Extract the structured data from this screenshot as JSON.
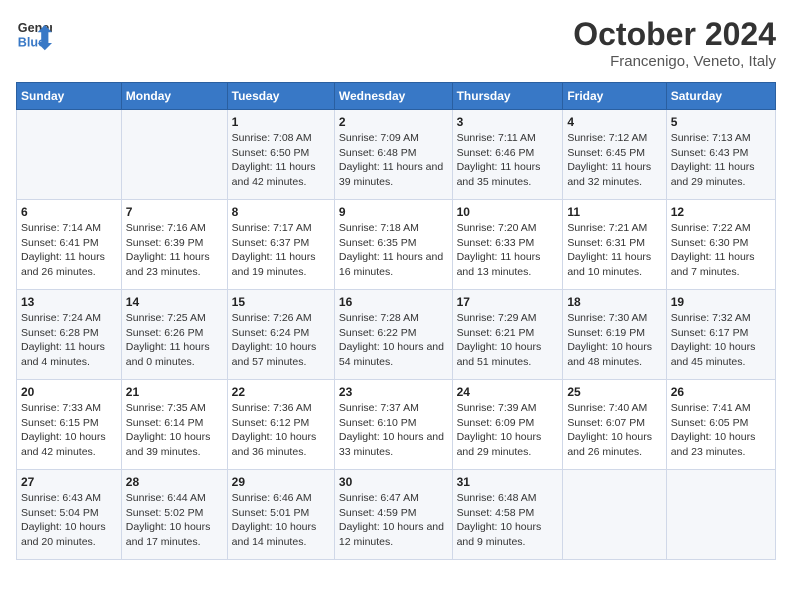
{
  "header": {
    "logo_line1": "General",
    "logo_line2": "Blue",
    "title": "October 2024",
    "subtitle": "Francenigo, Veneto, Italy"
  },
  "weekdays": [
    "Sunday",
    "Monday",
    "Tuesday",
    "Wednesday",
    "Thursday",
    "Friday",
    "Saturday"
  ],
  "weeks": [
    [
      {
        "day": "",
        "info": ""
      },
      {
        "day": "",
        "info": ""
      },
      {
        "day": "1",
        "info": "Sunrise: 7:08 AM\nSunset: 6:50 PM\nDaylight: 11 hours and 42 minutes."
      },
      {
        "day": "2",
        "info": "Sunrise: 7:09 AM\nSunset: 6:48 PM\nDaylight: 11 hours and 39 minutes."
      },
      {
        "day": "3",
        "info": "Sunrise: 7:11 AM\nSunset: 6:46 PM\nDaylight: 11 hours and 35 minutes."
      },
      {
        "day": "4",
        "info": "Sunrise: 7:12 AM\nSunset: 6:45 PM\nDaylight: 11 hours and 32 minutes."
      },
      {
        "day": "5",
        "info": "Sunrise: 7:13 AM\nSunset: 6:43 PM\nDaylight: 11 hours and 29 minutes."
      }
    ],
    [
      {
        "day": "6",
        "info": "Sunrise: 7:14 AM\nSunset: 6:41 PM\nDaylight: 11 hours and 26 minutes."
      },
      {
        "day": "7",
        "info": "Sunrise: 7:16 AM\nSunset: 6:39 PM\nDaylight: 11 hours and 23 minutes."
      },
      {
        "day": "8",
        "info": "Sunrise: 7:17 AM\nSunset: 6:37 PM\nDaylight: 11 hours and 19 minutes."
      },
      {
        "day": "9",
        "info": "Sunrise: 7:18 AM\nSunset: 6:35 PM\nDaylight: 11 hours and 16 minutes."
      },
      {
        "day": "10",
        "info": "Sunrise: 7:20 AM\nSunset: 6:33 PM\nDaylight: 11 hours and 13 minutes."
      },
      {
        "day": "11",
        "info": "Sunrise: 7:21 AM\nSunset: 6:31 PM\nDaylight: 11 hours and 10 minutes."
      },
      {
        "day": "12",
        "info": "Sunrise: 7:22 AM\nSunset: 6:30 PM\nDaylight: 11 hours and 7 minutes."
      }
    ],
    [
      {
        "day": "13",
        "info": "Sunrise: 7:24 AM\nSunset: 6:28 PM\nDaylight: 11 hours and 4 minutes."
      },
      {
        "day": "14",
        "info": "Sunrise: 7:25 AM\nSunset: 6:26 PM\nDaylight: 11 hours and 0 minutes."
      },
      {
        "day": "15",
        "info": "Sunrise: 7:26 AM\nSunset: 6:24 PM\nDaylight: 10 hours and 57 minutes."
      },
      {
        "day": "16",
        "info": "Sunrise: 7:28 AM\nSunset: 6:22 PM\nDaylight: 10 hours and 54 minutes."
      },
      {
        "day": "17",
        "info": "Sunrise: 7:29 AM\nSunset: 6:21 PM\nDaylight: 10 hours and 51 minutes."
      },
      {
        "day": "18",
        "info": "Sunrise: 7:30 AM\nSunset: 6:19 PM\nDaylight: 10 hours and 48 minutes."
      },
      {
        "day": "19",
        "info": "Sunrise: 7:32 AM\nSunset: 6:17 PM\nDaylight: 10 hours and 45 minutes."
      }
    ],
    [
      {
        "day": "20",
        "info": "Sunrise: 7:33 AM\nSunset: 6:15 PM\nDaylight: 10 hours and 42 minutes."
      },
      {
        "day": "21",
        "info": "Sunrise: 7:35 AM\nSunset: 6:14 PM\nDaylight: 10 hours and 39 minutes."
      },
      {
        "day": "22",
        "info": "Sunrise: 7:36 AM\nSunset: 6:12 PM\nDaylight: 10 hours and 36 minutes."
      },
      {
        "day": "23",
        "info": "Sunrise: 7:37 AM\nSunset: 6:10 PM\nDaylight: 10 hours and 33 minutes."
      },
      {
        "day": "24",
        "info": "Sunrise: 7:39 AM\nSunset: 6:09 PM\nDaylight: 10 hours and 29 minutes."
      },
      {
        "day": "25",
        "info": "Sunrise: 7:40 AM\nSunset: 6:07 PM\nDaylight: 10 hours and 26 minutes."
      },
      {
        "day": "26",
        "info": "Sunrise: 7:41 AM\nSunset: 6:05 PM\nDaylight: 10 hours and 23 minutes."
      }
    ],
    [
      {
        "day": "27",
        "info": "Sunrise: 6:43 AM\nSunset: 5:04 PM\nDaylight: 10 hours and 20 minutes."
      },
      {
        "day": "28",
        "info": "Sunrise: 6:44 AM\nSunset: 5:02 PM\nDaylight: 10 hours and 17 minutes."
      },
      {
        "day": "29",
        "info": "Sunrise: 6:46 AM\nSunset: 5:01 PM\nDaylight: 10 hours and 14 minutes."
      },
      {
        "day": "30",
        "info": "Sunrise: 6:47 AM\nSunset: 4:59 PM\nDaylight: 10 hours and 12 minutes."
      },
      {
        "day": "31",
        "info": "Sunrise: 6:48 AM\nSunset: 4:58 PM\nDaylight: 10 hours and 9 minutes."
      },
      {
        "day": "",
        "info": ""
      },
      {
        "day": "",
        "info": ""
      }
    ]
  ]
}
